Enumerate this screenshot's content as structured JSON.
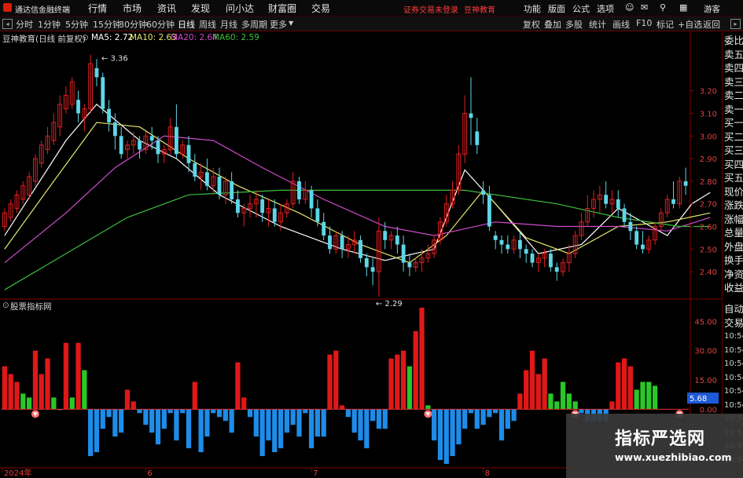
{
  "app": {
    "title": "通达信金融终端"
  },
  "menu": {
    "items": [
      "行情",
      "市场",
      "资讯",
      "发现",
      "问小达",
      "财富圈",
      "交易"
    ]
  },
  "notices": {
    "login": "证券交易未登录",
    "brand": "豆神教育"
  },
  "right_menu": {
    "items": [
      "功能",
      "版面",
      "公式",
      "选项"
    ],
    "guest": "游客"
  },
  "periods": {
    "items": [
      "分时",
      "1分钟",
      "5分钟",
      "15分钟",
      "30分钟",
      "60分钟",
      "日线",
      "周线",
      "月线",
      "多周期",
      "更多"
    ],
    "active": "日线"
  },
  "tools": {
    "items": [
      "复权",
      "叠加",
      "多股",
      "统计",
      "画线",
      "F10",
      "标记",
      "+自选",
      "返回"
    ]
  },
  "main_title": "豆神教育(日线 前复权)",
  "ma_legend": [
    {
      "label": "MA5: 2.72",
      "color": "#ffffff"
    },
    {
      "label": "MA10: 2.63",
      "color": "#e6e66e"
    },
    {
      "label": "MA20: 2.64",
      "color": "#d04ad0"
    },
    {
      "label": "MA60: 2.59",
      "color": "#3cbe3c"
    }
  ],
  "price_axis": [
    "3.20",
    "3.10",
    "3.00",
    "2.90",
    "2.80",
    "2.70",
    "2.60",
    "2.50",
    "2.40"
  ],
  "annotations": {
    "high": "3.36",
    "low": "2.29"
  },
  "sidebar_quote": [
    "委比",
    "卖五",
    "卖四",
    "卖三",
    "卖二",
    "卖一",
    "买一",
    "买二",
    "买三",
    "买四",
    "买五",
    "现价",
    "涨跌",
    "涨幅",
    "总量",
    "外盘",
    "换手",
    "净资",
    "收益"
  ],
  "indicator_title": "股票指标网",
  "indicator_axis": [
    "45.00",
    "30.00",
    "15.00",
    "0.00"
  ],
  "indicator_current": "5.68",
  "sidebar_ticks": [
    "自动",
    "交易",
    "10:54",
    "10:54",
    "10:54",
    "10:54",
    "10:54",
    "10:54",
    "10:54",
    "10:54",
    "10:54",
    "10:54"
  ],
  "date_axis": [
    "2024年",
    "6",
    "7",
    "8"
  ],
  "watermark": {
    "title": "指标严选网",
    "url": "www.xuezhibiao.com"
  },
  "colors": {
    "up": "#e02020",
    "down": "#5ed6e6",
    "bar_red": "#e01818",
    "bar_green": "#28c828",
    "bar_blue": "#1e8ce8",
    "ma5": "#ffffff",
    "ma10": "#e6e66e",
    "ma20": "#d04ad0",
    "ma60": "#3cbe3c"
  },
  "chart_data": {
    "type": "candlestick",
    "ylim": [
      2.3,
      3.4
    ],
    "candles": [
      [
        2.6,
        2.68,
        2.66,
        2.58
      ],
      [
        2.64,
        2.72,
        2.7,
        2.62
      ],
      [
        2.68,
        2.76,
        2.74,
        2.66
      ],
      [
        2.72,
        2.8,
        2.78,
        2.7
      ],
      [
        2.74,
        2.84,
        2.82,
        2.72
      ],
      [
        2.8,
        2.92,
        2.9,
        2.78
      ],
      [
        2.88,
        2.98,
        2.96,
        2.86
      ],
      [
        2.94,
        3.04,
        3.0,
        2.92
      ],
      [
        2.98,
        3.1,
        3.06,
        2.96
      ],
      [
        3.04,
        3.18,
        3.14,
        3.0
      ],
      [
        3.12,
        3.22,
        3.18,
        3.1
      ],
      [
        3.14,
        3.26,
        3.24,
        3.12
      ],
      [
        3.16,
        3.2,
        3.1,
        3.06
      ],
      [
        3.08,
        3.14,
        3.12,
        3.02
      ],
      [
        3.12,
        3.36,
        3.32,
        3.1
      ],
      [
        3.3,
        3.34,
        3.26,
        3.22
      ],
      [
        3.26,
        3.28,
        3.12,
        3.1
      ],
      [
        3.12,
        3.16,
        3.06,
        3.02
      ],
      [
        3.06,
        3.1,
        3.0,
        2.94
      ],
      [
        3.0,
        3.04,
        2.92,
        2.9
      ],
      [
        2.94,
        2.98,
        2.96,
        2.9
      ],
      [
        2.96,
        3.02,
        2.98,
        2.92
      ],
      [
        2.98,
        3.0,
        2.94,
        2.9
      ],
      [
        2.94,
        3.02,
        3.0,
        2.92
      ],
      [
        3.0,
        3.04,
        2.98,
        2.94
      ],
      [
        2.98,
        3.0,
        2.92,
        2.88
      ],
      [
        2.92,
        2.96,
        2.94,
        2.88
      ],
      [
        2.94,
        3.08,
        3.04,
        2.92
      ],
      [
        3.04,
        3.14,
        2.92,
        2.9
      ],
      [
        2.92,
        2.98,
        2.96,
        2.9
      ],
      [
        2.96,
        3.0,
        2.88,
        2.84
      ],
      [
        2.88,
        2.92,
        2.82,
        2.8
      ],
      [
        2.82,
        2.88,
        2.84,
        2.76
      ],
      [
        2.84,
        2.9,
        2.78,
        2.76
      ],
      [
        2.78,
        2.86,
        2.82,
        2.74
      ],
      [
        2.82,
        2.86,
        2.74,
        2.72
      ],
      [
        2.74,
        2.82,
        2.8,
        2.7
      ],
      [
        2.8,
        2.84,
        2.72,
        2.7
      ],
      [
        2.72,
        2.76,
        2.66,
        2.64
      ],
      [
        2.66,
        2.7,
        2.68,
        2.6
      ],
      [
        2.68,
        2.74,
        2.7,
        2.64
      ],
      [
        2.7,
        2.76,
        2.72,
        2.64
      ],
      [
        2.72,
        2.74,
        2.66,
        2.62
      ],
      [
        2.66,
        2.72,
        2.68,
        2.6
      ],
      [
        2.68,
        2.72,
        2.62,
        2.6
      ],
      [
        2.62,
        2.7,
        2.66,
        2.58
      ],
      [
        2.66,
        2.72,
        2.7,
        2.64
      ],
      [
        2.7,
        2.84,
        2.8,
        2.68
      ],
      [
        2.8,
        2.82,
        2.72,
        2.7
      ],
      [
        2.72,
        2.8,
        2.76,
        2.7
      ],
      [
        2.76,
        2.78,
        2.68,
        2.64
      ],
      [
        2.68,
        2.72,
        2.62,
        2.6
      ],
      [
        2.62,
        2.66,
        2.56,
        2.54
      ],
      [
        2.56,
        2.6,
        2.5,
        2.48
      ],
      [
        2.5,
        2.58,
        2.56,
        2.48
      ],
      [
        2.56,
        2.58,
        2.5,
        2.46
      ],
      [
        2.5,
        2.56,
        2.52,
        2.46
      ],
      [
        2.52,
        2.58,
        2.54,
        2.48
      ],
      [
        2.54,
        2.56,
        2.46,
        2.44
      ],
      [
        2.46,
        2.48,
        2.42,
        2.38
      ],
      [
        2.42,
        2.46,
        2.4,
        2.34
      ],
      [
        2.4,
        2.64,
        2.58,
        2.29
      ],
      [
        2.58,
        2.62,
        2.54,
        2.5
      ],
      [
        2.54,
        2.58,
        2.56,
        2.5
      ],
      [
        2.56,
        2.6,
        2.52,
        2.48
      ],
      [
        2.52,
        2.56,
        2.44,
        2.4
      ],
      [
        2.44,
        2.48,
        2.42,
        2.38
      ],
      [
        2.42,
        2.46,
        2.44,
        2.4
      ],
      [
        2.44,
        2.5,
        2.46,
        2.4
      ],
      [
        2.46,
        2.52,
        2.48,
        2.44
      ],
      [
        2.48,
        2.56,
        2.54,
        2.46
      ],
      [
        2.54,
        2.64,
        2.62,
        2.52
      ],
      [
        2.62,
        2.74,
        2.7,
        2.6
      ],
      [
        2.7,
        2.8,
        2.76,
        2.68
      ],
      [
        2.76,
        2.96,
        2.92,
        2.74
      ],
      [
        2.92,
        3.18,
        3.1,
        2.88
      ],
      [
        3.1,
        3.26,
        3.08,
        2.96
      ],
      [
        3.02,
        3.08,
        2.96,
        2.92
      ],
      [
        2.76,
        2.8,
        2.74,
        2.7
      ],
      [
        2.74,
        2.78,
        2.6,
        2.58
      ],
      [
        2.56,
        2.58,
        2.54,
        2.5
      ],
      [
        2.54,
        2.56,
        2.52,
        2.48
      ],
      [
        2.52,
        2.56,
        2.5,
        2.48
      ],
      [
        2.5,
        2.56,
        2.54,
        2.48
      ],
      [
        2.54,
        2.58,
        2.5,
        2.46
      ],
      [
        2.5,
        2.52,
        2.48,
        2.44
      ],
      [
        2.48,
        2.5,
        2.44,
        2.42
      ],
      [
        2.44,
        2.48,
        2.46,
        2.4
      ],
      [
        2.46,
        2.5,
        2.48,
        2.42
      ],
      [
        2.48,
        2.5,
        2.42,
        2.4
      ],
      [
        2.42,
        2.44,
        2.4,
        2.36
      ],
      [
        2.4,
        2.46,
        2.44,
        2.38
      ],
      [
        2.44,
        2.52,
        2.48,
        2.4
      ],
      [
        2.48,
        2.58,
        2.56,
        2.46
      ],
      [
        2.56,
        2.66,
        2.62,
        2.54
      ],
      [
        2.62,
        2.74,
        2.68,
        2.6
      ],
      [
        2.68,
        2.76,
        2.72,
        2.64
      ],
      [
        2.72,
        2.78,
        2.74,
        2.66
      ],
      [
        2.74,
        2.8,
        2.7,
        2.68
      ],
      [
        2.7,
        2.76,
        2.72,
        2.66
      ],
      [
        2.72,
        2.76,
        2.68,
        2.64
      ],
      [
        2.68,
        2.7,
        2.62,
        2.6
      ],
      [
        2.62,
        2.66,
        2.58,
        2.54
      ],
      [
        2.58,
        2.6,
        2.52,
        2.5
      ],
      [
        2.52,
        2.58,
        2.5,
        2.48
      ],
      [
        2.5,
        2.56,
        2.54,
        2.48
      ],
      [
        2.54,
        2.62,
        2.6,
        2.52
      ],
      [
        2.6,
        2.68,
        2.66,
        2.58
      ],
      [
        2.66,
        2.74,
        2.72,
        2.64
      ],
      [
        2.72,
        2.8,
        2.7,
        2.68
      ],
      [
        2.7,
        2.82,
        2.8,
        2.68
      ],
      [
        2.8,
        2.86,
        2.78,
        2.74
      ]
    ],
    "ma": [
      {
        "name": "MA5",
        "color": "#ffffff",
        "points": [
          [
            0,
            2.56
          ],
          [
            10,
            2.98
          ],
          [
            15,
            3.14
          ],
          [
            22,
            2.98
          ],
          [
            28,
            2.9
          ],
          [
            35,
            2.74
          ],
          [
            45,
            2.6
          ],
          [
            55,
            2.5
          ],
          [
            62,
            2.45
          ],
          [
            70,
            2.5
          ],
          [
            75,
            2.85
          ],
          [
            80,
            2.7
          ],
          [
            87,
            2.48
          ],
          [
            94,
            2.52
          ],
          [
            100,
            2.68
          ],
          [
            108,
            2.56
          ],
          [
            112,
            2.7
          ],
          [
            115,
            2.75
          ]
        ]
      },
      {
        "name": "MA10",
        "color": "#e6e66e",
        "points": [
          [
            0,
            2.5
          ],
          [
            8,
            2.8
          ],
          [
            15,
            3.06
          ],
          [
            22,
            3.04
          ],
          [
            30,
            2.9
          ],
          [
            38,
            2.78
          ],
          [
            48,
            2.66
          ],
          [
            58,
            2.52
          ],
          [
            66,
            2.44
          ],
          [
            72,
            2.56
          ],
          [
            78,
            2.76
          ],
          [
            85,
            2.55
          ],
          [
            92,
            2.48
          ],
          [
            100,
            2.6
          ],
          [
            108,
            2.62
          ],
          [
            115,
            2.66
          ]
        ]
      },
      {
        "name": "MA20",
        "color": "#d04ad0",
        "points": [
          [
            0,
            2.44
          ],
          [
            10,
            2.66
          ],
          [
            18,
            2.86
          ],
          [
            26,
            3.0
          ],
          [
            34,
            2.98
          ],
          [
            42,
            2.86
          ],
          [
            52,
            2.72
          ],
          [
            62,
            2.6
          ],
          [
            70,
            2.56
          ],
          [
            80,
            2.62
          ],
          [
            90,
            2.6
          ],
          [
            100,
            2.6
          ],
          [
            108,
            2.58
          ],
          [
            115,
            2.64
          ]
        ]
      },
      {
        "name": "MA60",
        "color": "#3cbe3c",
        "points": [
          [
            0,
            2.32
          ],
          [
            10,
            2.48
          ],
          [
            20,
            2.64
          ],
          [
            30,
            2.74
          ],
          [
            45,
            2.76
          ],
          [
            60,
            2.76
          ],
          [
            75,
            2.76
          ],
          [
            90,
            2.7
          ],
          [
            100,
            2.64
          ],
          [
            110,
            2.6
          ],
          [
            115,
            2.6
          ]
        ]
      }
    ],
    "indicator": {
      "ylim": [
        -30,
        52
      ],
      "values": [
        [
          22,
          "r"
        ],
        [
          18,
          "r"
        ],
        [
          14,
          "r"
        ],
        [
          8,
          "g"
        ],
        [
          6,
          "g"
        ],
        [
          30,
          "r"
        ],
        [
          18,
          "r"
        ],
        [
          26,
          "r"
        ],
        [
          6,
          "g"
        ],
        [
          0,
          "n"
        ],
        [
          34,
          "r"
        ],
        [
          6,
          "g"
        ],
        [
          34,
          "r"
        ],
        [
          20,
          "g"
        ],
        [
          -24,
          "b"
        ],
        [
          -22,
          "b"
        ],
        [
          -10,
          "b"
        ],
        [
          -4,
          "b"
        ],
        [
          -14,
          "b"
        ],
        [
          -12,
          "b"
        ],
        [
          10,
          "r"
        ],
        [
          4,
          "r"
        ],
        [
          -2,
          "b"
        ],
        [
          -8,
          "b"
        ],
        [
          -12,
          "b"
        ],
        [
          -18,
          "b"
        ],
        [
          -10,
          "b"
        ],
        [
          -2,
          "b"
        ],
        [
          -16,
          "b"
        ],
        [
          -2,
          "b"
        ],
        [
          -20,
          "b"
        ],
        [
          14,
          "r"
        ],
        [
          -22,
          "b"
        ],
        [
          -14,
          "b"
        ],
        [
          -2,
          "b"
        ],
        [
          -4,
          "b"
        ],
        [
          -6,
          "b"
        ],
        [
          -12,
          "b"
        ],
        [
          24,
          "r"
        ],
        [
          6,
          "r"
        ],
        [
          -4,
          "b"
        ],
        [
          -14,
          "b"
        ],
        [
          -24,
          "b"
        ],
        [
          -16,
          "b"
        ],
        [
          -22,
          "b"
        ],
        [
          -20,
          "b"
        ],
        [
          -12,
          "b"
        ],
        [
          -8,
          "b"
        ],
        [
          -14,
          "b"
        ],
        [
          -2,
          "b"
        ],
        [
          -20,
          "b"
        ],
        [
          -14,
          "b"
        ],
        [
          -14,
          "b"
        ],
        [
          28,
          "r"
        ],
        [
          30,
          "r"
        ],
        [
          2,
          "r"
        ],
        [
          -4,
          "b"
        ],
        [
          -12,
          "b"
        ],
        [
          -16,
          "b"
        ],
        [
          -20,
          "b"
        ],
        [
          -6,
          "b"
        ],
        [
          -10,
          "b"
        ],
        [
          -10,
          "b"
        ],
        [
          26,
          "r"
        ],
        [
          28,
          "r"
        ],
        [
          30,
          "r"
        ],
        [
          22,
          "g"
        ],
        [
          40,
          "r"
        ],
        [
          52,
          "r"
        ],
        [
          2,
          "g"
        ],
        [
          -16,
          "b"
        ],
        [
          -26,
          "b"
        ],
        [
          -28,
          "b"
        ],
        [
          -24,
          "b"
        ],
        [
          -18,
          "b"
        ],
        [
          -10,
          "b"
        ],
        [
          -2,
          "b"
        ],
        [
          -10,
          "b"
        ],
        [
          -8,
          "b"
        ],
        [
          -4,
          "b"
        ],
        [
          -2,
          "b"
        ],
        [
          -16,
          "b"
        ],
        [
          -10,
          "b"
        ],
        [
          -6,
          "b"
        ],
        [
          8,
          "r"
        ],
        [
          20,
          "r"
        ],
        [
          30,
          "r"
        ],
        [
          18,
          "r"
        ],
        [
          26,
          "r"
        ],
        [
          8,
          "g"
        ],
        [
          4,
          "g"
        ],
        [
          14,
          "g"
        ],
        [
          8,
          "g"
        ],
        [
          4,
          "g"
        ],
        [
          -2,
          "b"
        ],
        [
          -6,
          "b"
        ],
        [
          -6,
          "b"
        ],
        [
          -6,
          "b"
        ],
        [
          -6,
          "b"
        ],
        [
          4,
          "r"
        ],
        [
          24,
          "r"
        ],
        [
          26,
          "r"
        ],
        [
          22,
          "r"
        ],
        [
          10,
          "g"
        ],
        [
          14,
          "g"
        ],
        [
          14,
          "g"
        ],
        [
          12,
          "g"
        ]
      ],
      "signals": [
        5,
        69,
        93,
        110
      ]
    }
  }
}
